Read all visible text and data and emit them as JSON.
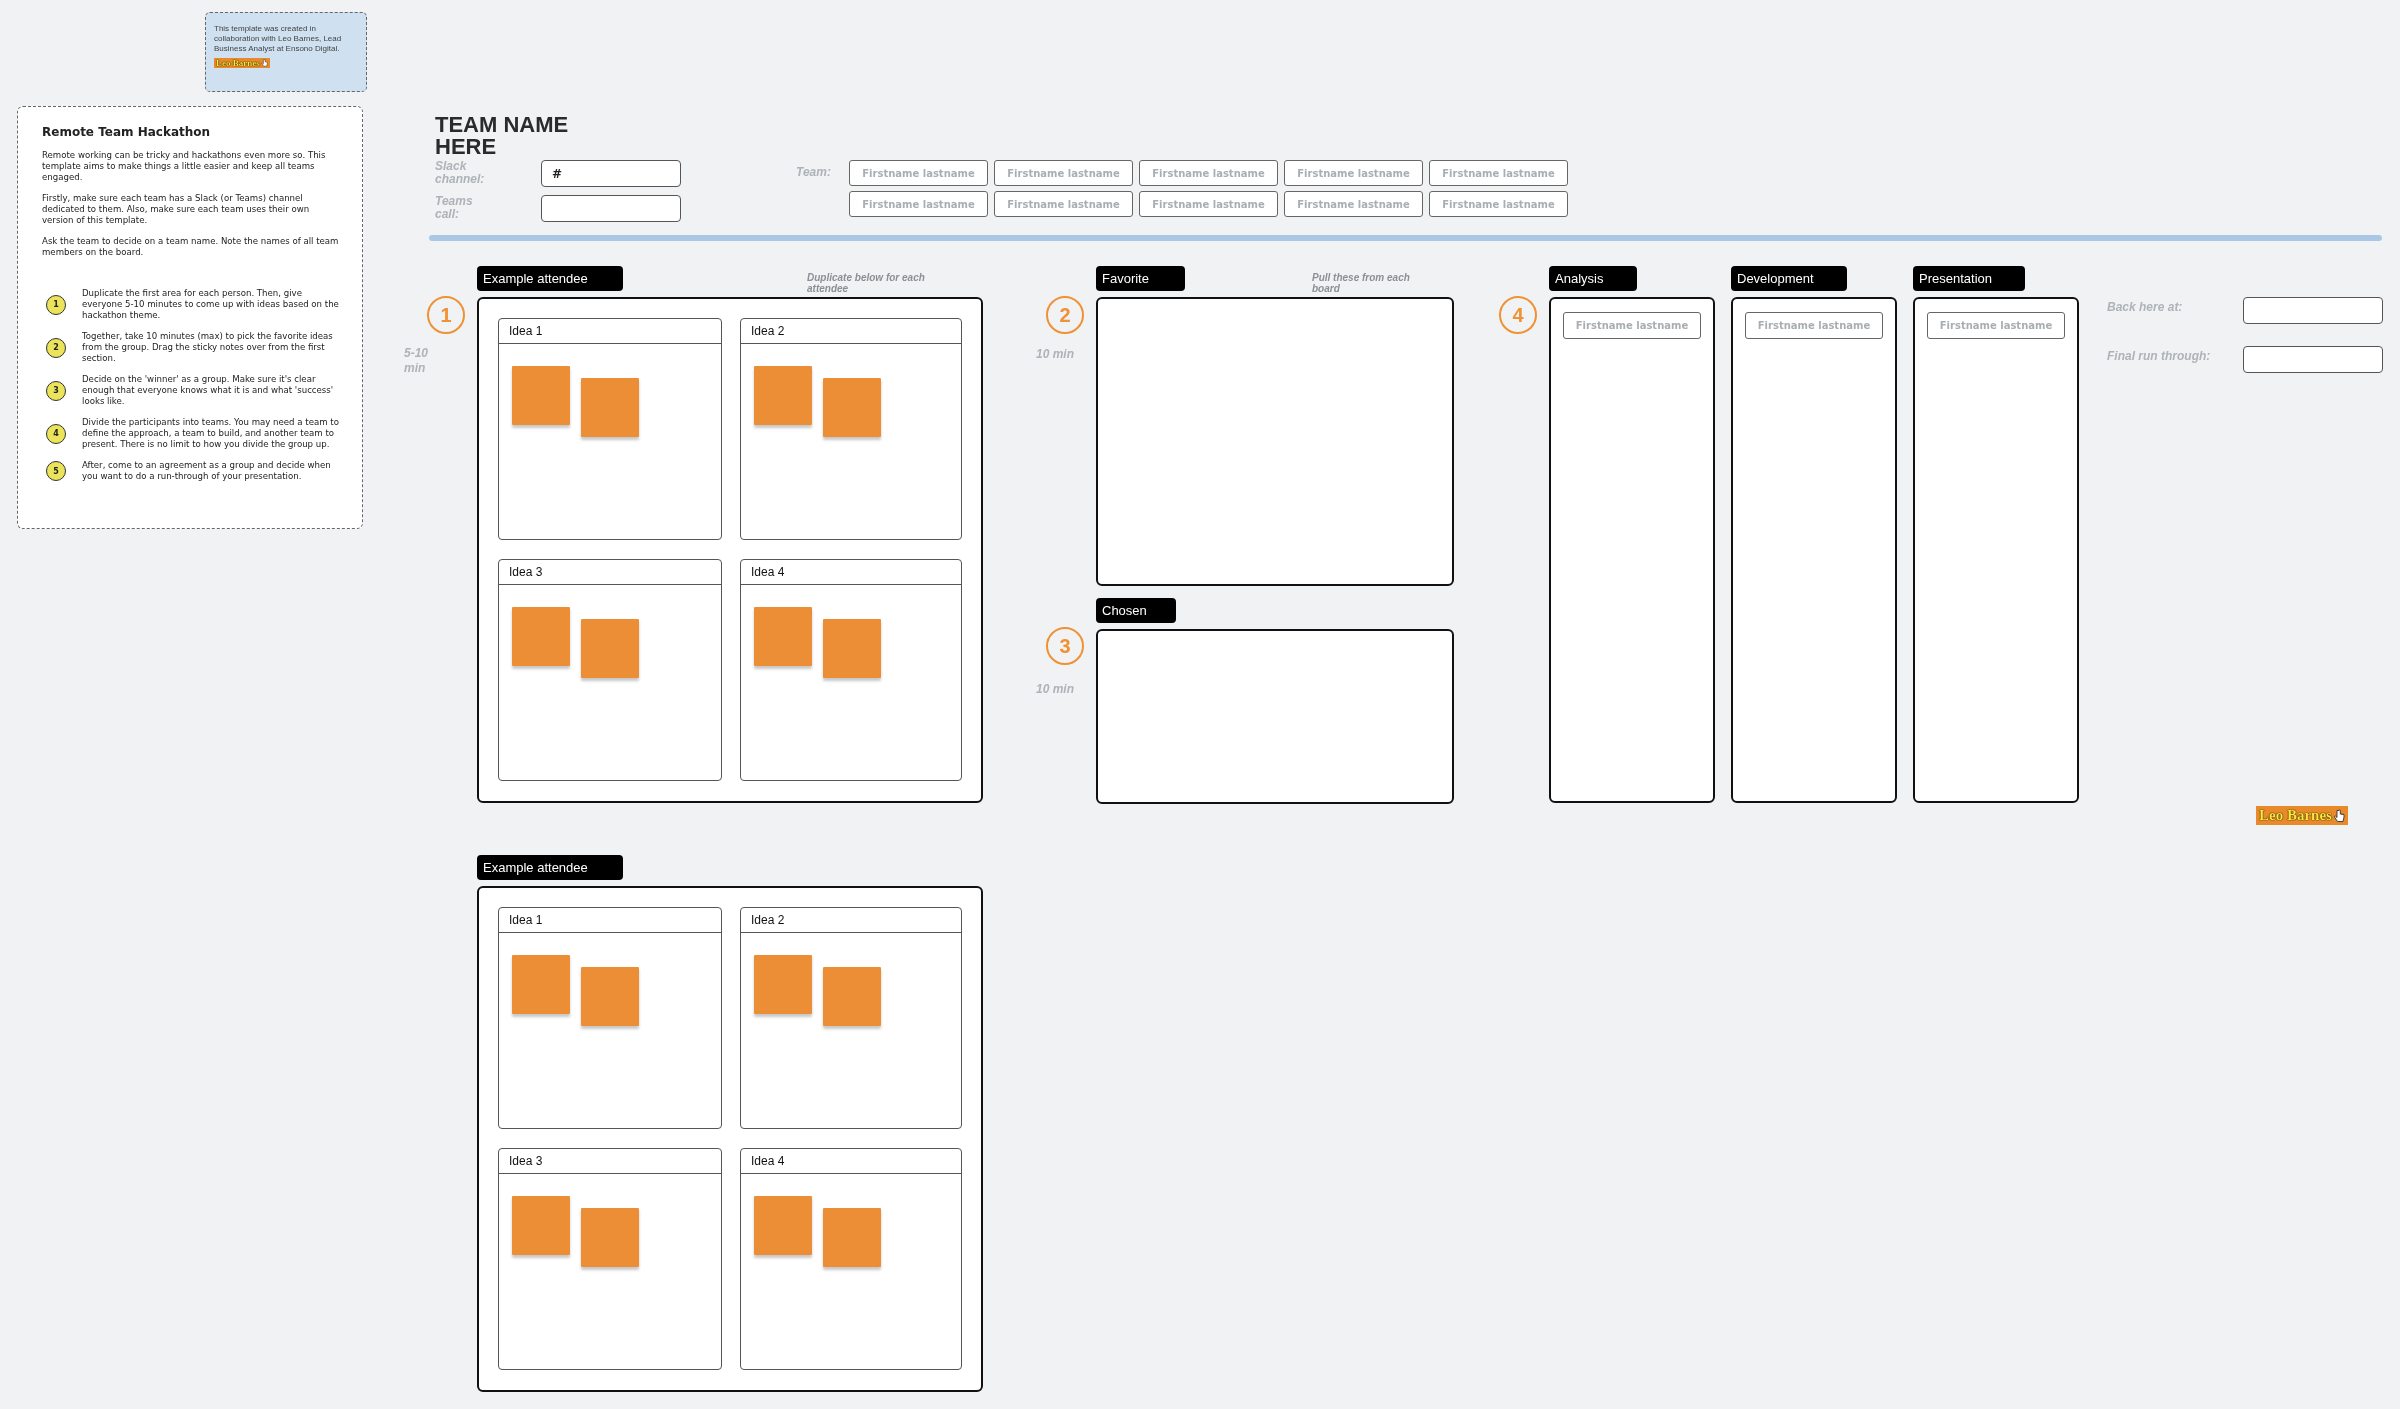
{
  "credit_note": {
    "text": "This template was created in collaboration with Leo Barnes, Lead Business Analyst at Ensono Digital.",
    "badge": "Leo Barnes"
  },
  "instructions": {
    "title": "Remote Team Hackathon",
    "paragraphs": [
      "Remote working can be tricky and hackathons even more so. This template aims to make things a little easier and keep all teams engaged.",
      "Firstly, make sure each team has a Slack (or Teams) channel dedicated to them. Also, make sure each team uses their own version of this template.",
      "Ask the team to decide on a team name. Note the names of all team members on the board."
    ],
    "steps": [
      {
        "number": "1",
        "text": "Duplicate the first area for each person. Then, give everyone 5-10 minutes to come up with ideas based on the hackathon theme."
      },
      {
        "number": "2",
        "text": "Together, take 10 minutes (max) to pick the favorite ideas from the group. Drag the sticky notes over from the first section."
      },
      {
        "number": "3",
        "text": "Decide on the 'winner' as a group. Make sure it's clear enough that everyone knows what it is and what 'success' looks like."
      },
      {
        "number": "4",
        "text": "Divide the participants into teams. You may need a team to define the approach, a team to build, and another team to present. There is no limit to how you divide the group up."
      },
      {
        "number": "5",
        "text": "After, come to an agreement as a group and decide when you want to do a run-through of your presentation."
      }
    ]
  },
  "header": {
    "team_name": "TEAM NAME HERE",
    "fields": [
      {
        "label": "Slack channel:",
        "value": "#"
      },
      {
        "label": "Teams call:"
      }
    ],
    "team_label": "Team:",
    "members": [
      {
        "placeholder": "Firstname lastname"
      },
      {
        "placeholder": "Firstname lastname"
      },
      {
        "placeholder": "Firstname lastname"
      },
      {
        "placeholder": "Firstname lastname"
      },
      {
        "placeholder": "Firstname lastname"
      },
      {
        "placeholder": "Firstname lastname"
      },
      {
        "placeholder": "Firstname lastname"
      },
      {
        "placeholder": "Firstname lastname"
      },
      {
        "placeholder": "Firstname lastname"
      },
      {
        "placeholder": "Firstname lastname"
      }
    ]
  },
  "ideation": {
    "number": "1",
    "duration": "5-10 min",
    "hint": "Duplicate below for each attendee",
    "boards": [
      {
        "tag": "Example attendee",
        "ideas": [
          {
            "title": "Idea 1",
            "notes": [
              {
                "kind": "sticky"
              },
              {
                "kind": "sticky"
              }
            ]
          },
          {
            "title": "Idea 2",
            "notes": [
              {
                "kind": "sticky"
              },
              {
                "kind": "sticky"
              }
            ]
          },
          {
            "title": "Idea 3",
            "notes": [
              {
                "kind": "sticky"
              },
              {
                "kind": "sticky"
              }
            ]
          },
          {
            "title": "Idea 4",
            "notes": [
              {
                "kind": "sticky"
              },
              {
                "kind": "sticky"
              }
            ]
          }
        ]
      },
      {
        "tag": "Example attendee",
        "ideas": [
          {
            "title": "Idea 1",
            "notes": [
              {
                "kind": "sticky"
              },
              {
                "kind": "sticky"
              }
            ]
          },
          {
            "title": "Idea 2",
            "notes": [
              {
                "kind": "sticky"
              },
              {
                "kind": "sticky"
              }
            ]
          },
          {
            "title": "Idea 3",
            "notes": [
              {
                "kind": "sticky"
              },
              {
                "kind": "sticky"
              }
            ]
          },
          {
            "title": "Idea 4",
            "notes": [
              {
                "kind": "sticky"
              },
              {
                "kind": "sticky"
              }
            ]
          }
        ]
      }
    ]
  },
  "favorite": {
    "number": "2",
    "duration": "10 min",
    "tag": "Favorite",
    "hint": "Pull these from each board"
  },
  "chosen": {
    "number": "3",
    "duration": "10 min",
    "tag": "Chosen"
  },
  "teams": {
    "number": "4",
    "columns": [
      {
        "tag": "Analysis",
        "members": [
          {
            "placeholder": "Firstname lastname"
          }
        ]
      },
      {
        "tag": "Development",
        "members": [
          {
            "placeholder": "Firstname lastname"
          }
        ]
      },
      {
        "tag": "Presentation",
        "members": [
          {
            "placeholder": "Firstname lastname"
          }
        ]
      }
    ]
  },
  "schedule": [
    {
      "label": "Back here at:"
    },
    {
      "label": "Final run through:"
    }
  ],
  "signature": "Leo Barnes"
}
